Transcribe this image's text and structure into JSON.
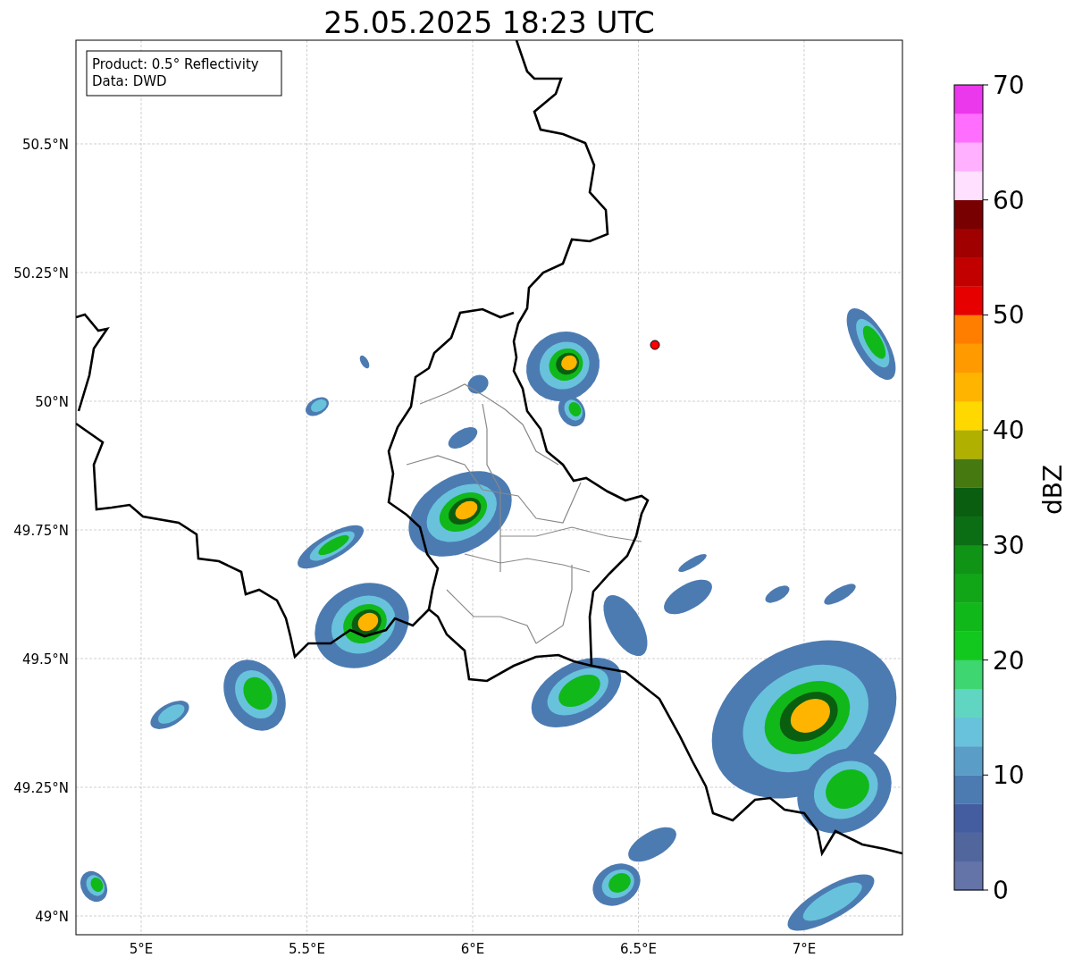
{
  "title": "25.05.2025 18:23 UTC",
  "map": {
    "legend": [
      "Product: 0.5° Reflectivity",
      "Data: DWD"
    ],
    "lat_ticks": [
      "50.5°N",
      "50.25°N",
      "50°N",
      "49.75°N",
      "49.5°N",
      "49.25°N",
      "49°N"
    ],
    "lon_ticks": [
      "5°E",
      "5.5°E",
      "6°E",
      "6.5°E",
      "7°E"
    ]
  },
  "colorbar": {
    "label": "dBZ",
    "ticks": [
      "70",
      "60",
      "50",
      "40",
      "30",
      "20",
      "10",
      "0"
    ],
    "segments": [
      {
        "color": "#6473a8"
      },
      {
        "color": "#52669e"
      },
      {
        "color": "#435da0"
      },
      {
        "color": "#4c7bb2"
      },
      {
        "color": "#5a9ec8"
      },
      {
        "color": "#68c2dc"
      },
      {
        "color": "#60d6c2"
      },
      {
        "color": "#3ed670"
      },
      {
        "color": "#12c81e"
      },
      {
        "color": "#10b81a"
      },
      {
        "color": "#10a618"
      },
      {
        "color": "#0f9416"
      },
      {
        "color": "#0c6e14"
      },
      {
        "color": "#0a5e10"
      },
      {
        "color": "#467a10"
      },
      {
        "color": "#b0b000"
      },
      {
        "color": "#ffd800"
      },
      {
        "color": "#ffb400"
      },
      {
        "color": "#ff9a00"
      },
      {
        "color": "#ff7e00"
      },
      {
        "color": "#e60000"
      },
      {
        "color": "#c20000"
      },
      {
        "color": "#a00000"
      },
      {
        "color": "#780000"
      },
      {
        "color": "#ffe0ff"
      },
      {
        "color": "#ffb0ff"
      },
      {
        "color": "#ff6eff"
      },
      {
        "color": "#ec38ec"
      }
    ]
  }
}
